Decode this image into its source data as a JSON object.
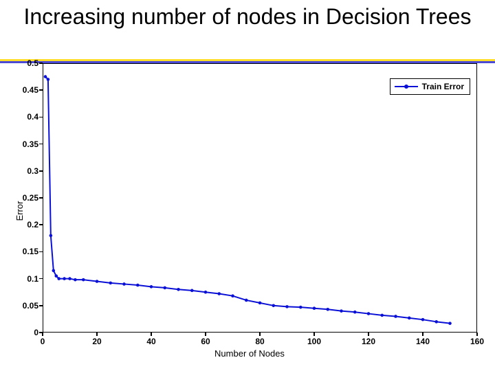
{
  "slide_title": "Increasing number of nodes in Decision Trees",
  "legend_label": "Train Error",
  "axes": {
    "xlabel": "Number of Nodes",
    "ylabel": "Error",
    "xlim": [
      0,
      160
    ],
    "ylim": [
      0,
      0.5
    ],
    "xticks": [
      0,
      20,
      40,
      60,
      80,
      100,
      120,
      140,
      160
    ],
    "yticks": [
      0,
      0.05,
      0.1,
      0.15,
      0.2,
      0.25,
      0.3,
      0.35,
      0.4,
      0.45,
      0.5
    ],
    "ytick_labels": [
      "0",
      "0.05",
      "0.1",
      "0.15",
      "0.2",
      "0.25",
      "0.3",
      "0.35",
      "0.4",
      "0.45",
      "0.5"
    ]
  },
  "series_color": "#0a10d6",
  "chart_data": {
    "type": "line",
    "title": "Increasing number of nodes in Decision Trees",
    "xlabel": "Number of Nodes",
    "ylabel": "Error",
    "xlim": [
      0,
      160
    ],
    "ylim": [
      0,
      0.5
    ],
    "series": [
      {
        "name": "Train Error",
        "x": [
          1,
          2,
          3,
          4,
          5,
          6,
          8,
          10,
          12,
          15,
          20,
          25,
          30,
          35,
          40,
          45,
          50,
          55,
          60,
          65,
          70,
          75,
          80,
          85,
          90,
          95,
          100,
          105,
          110,
          115,
          120,
          125,
          130,
          135,
          140,
          145,
          150
        ],
        "y": [
          0.475,
          0.47,
          0.18,
          0.115,
          0.105,
          0.1,
          0.1,
          0.1,
          0.098,
          0.098,
          0.095,
          0.092,
          0.09,
          0.088,
          0.085,
          0.083,
          0.08,
          0.078,
          0.075,
          0.072,
          0.068,
          0.06,
          0.055,
          0.05,
          0.048,
          0.047,
          0.045,
          0.043,
          0.04,
          0.038,
          0.035,
          0.032,
          0.03,
          0.027,
          0.024,
          0.02,
          0.017
        ]
      }
    ]
  }
}
